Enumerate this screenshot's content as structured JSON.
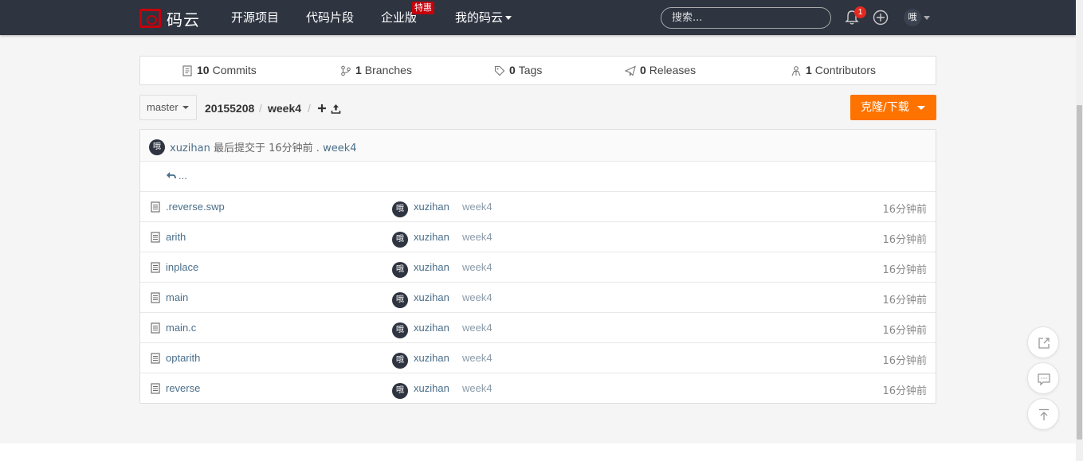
{
  "nav": {
    "logo": "码云",
    "links": [
      "开源项目",
      "代码片段",
      "企业版",
      "我的码云"
    ],
    "hot_badge": "特惠",
    "search_placeholder": "搜索...",
    "notification_count": "1",
    "avatar": "哦"
  },
  "stats": [
    {
      "count": "10",
      "label": "Commits",
      "icon": "commit-icon"
    },
    {
      "count": "1",
      "label": "Branches",
      "icon": "branch-icon"
    },
    {
      "count": "0",
      "label": "Tags",
      "icon": "tag-icon"
    },
    {
      "count": "0",
      "label": "Releases",
      "icon": "release-icon"
    },
    {
      "count": "1",
      "label": "Contributors",
      "icon": "contributors-icon"
    }
  ],
  "path": {
    "branch": "master",
    "crumbs": [
      "20155208",
      "week4"
    ],
    "separator": "/"
  },
  "clone_button": "克隆/下载",
  "last_commit": {
    "avatar": "哦",
    "user": "xuzihan",
    "text": "最后提交于 16分钟前 .",
    "message": "week4"
  },
  "parent_dir": "...",
  "files": [
    {
      "name": ".reverse.swp",
      "avatar": "哦",
      "user": "xuzihan",
      "message": "week4",
      "time": "16分钟前"
    },
    {
      "name": "arith",
      "avatar": "哦",
      "user": "xuzihan",
      "message": "week4",
      "time": "16分钟前"
    },
    {
      "name": "inplace",
      "avatar": "哦",
      "user": "xuzihan",
      "message": "week4",
      "time": "16分钟前"
    },
    {
      "name": "main",
      "avatar": "哦",
      "user": "xuzihan",
      "message": "week4",
      "time": "16分钟前"
    },
    {
      "name": "main.c",
      "avatar": "哦",
      "user": "xuzihan",
      "message": "week4",
      "time": "16分钟前"
    },
    {
      "name": "optarith",
      "avatar": "哦",
      "user": "xuzihan",
      "message": "week4",
      "time": "16分钟前"
    },
    {
      "name": "reverse",
      "avatar": "哦",
      "user": "xuzihan",
      "message": "week4",
      "time": "16分钟前"
    }
  ],
  "floating": [
    "share-icon",
    "comment-icon",
    "back-to-top-icon"
  ],
  "colors": {
    "nav_bg": "#2e3440",
    "brand_red": "#c7000b",
    "clone_orange": "#fe7300",
    "link": "#4a6e8a"
  }
}
